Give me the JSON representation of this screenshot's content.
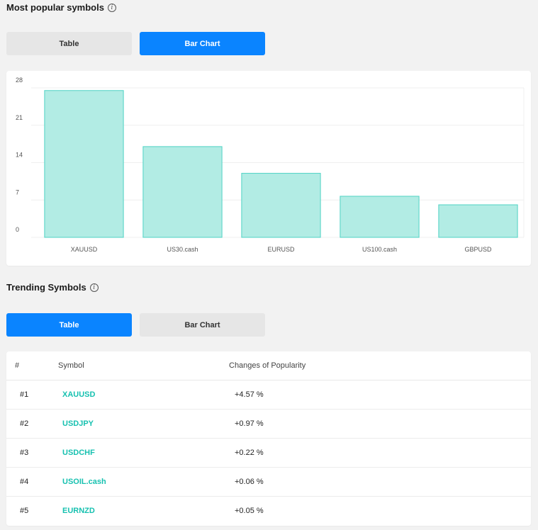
{
  "popular": {
    "title": "Most popular symbols",
    "info_icon": "i",
    "tabs": [
      {
        "label": "Table",
        "active": false
      },
      {
        "label": "Bar Chart",
        "active": true
      }
    ]
  },
  "chart_data": {
    "type": "bar",
    "categories": [
      "XAUUSD",
      "US30.cash",
      "EURUSD",
      "US100.cash",
      "GBPUSD"
    ],
    "values": [
      27.5,
      17,
      12,
      7.7,
      6.1
    ],
    "yticks": [
      0,
      7,
      14,
      21,
      28
    ],
    "ylim": [
      0,
      28
    ],
    "title": "",
    "xlabel": "",
    "ylabel": "",
    "bar_fill": "#b2ece4",
    "bar_stroke": "#4fd3c4",
    "grid": true
  },
  "trending": {
    "title": "Trending Symbols",
    "info_icon": "i",
    "tabs": [
      {
        "label": "Table",
        "active": true
      },
      {
        "label": "Bar Chart",
        "active": false
      }
    ],
    "columns": [
      "#",
      "Symbol",
      "Changes of Popularity"
    ],
    "rows": [
      {
        "rank": "#1",
        "symbol": "XAUUSD",
        "change": "+4.57 %"
      },
      {
        "rank": "#2",
        "symbol": "USDJPY",
        "change": "+0.97 %"
      },
      {
        "rank": "#3",
        "symbol": "USDCHF",
        "change": "+0.22 %"
      },
      {
        "rank": "#4",
        "symbol": "USOIL.cash",
        "change": "+0.06 %"
      },
      {
        "rank": "#5",
        "symbol": "EURNZD",
        "change": "+0.05 %"
      }
    ]
  },
  "colors": {
    "accent": "#0a84ff",
    "symbol_link": "#17c1b0",
    "background": "#f2f2f2"
  }
}
